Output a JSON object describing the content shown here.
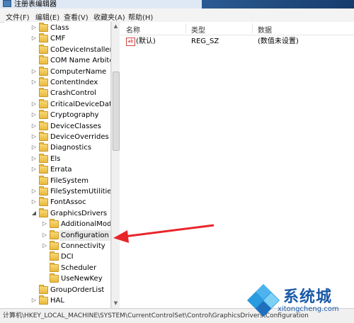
{
  "window": {
    "title": "注册表编辑器"
  },
  "menu": [
    "文件(F)",
    "编辑(E)",
    "查看(V)",
    "收藏夹(A)",
    "帮助(H)"
  ],
  "tree": [
    {
      "label": "Class",
      "indent": 0,
      "expander": "right"
    },
    {
      "label": "CMF",
      "indent": 0,
      "expander": "right"
    },
    {
      "label": "CoDeviceInstallers",
      "indent": 0,
      "expander": "none"
    },
    {
      "label": "COM Name Arbiter",
      "indent": 0,
      "expander": "none"
    },
    {
      "label": "ComputerName",
      "indent": 0,
      "expander": "right"
    },
    {
      "label": "ContentIndex",
      "indent": 0,
      "expander": "right"
    },
    {
      "label": "CrashControl",
      "indent": 0,
      "expander": "none"
    },
    {
      "label": "CriticalDeviceDatab",
      "indent": 0,
      "expander": "right"
    },
    {
      "label": "Cryptography",
      "indent": 0,
      "expander": "right"
    },
    {
      "label": "DeviceClasses",
      "indent": 0,
      "expander": "right"
    },
    {
      "label": "DeviceOverrides",
      "indent": 0,
      "expander": "right"
    },
    {
      "label": "Diagnostics",
      "indent": 0,
      "expander": "right"
    },
    {
      "label": "Els",
      "indent": 0,
      "expander": "right"
    },
    {
      "label": "Errata",
      "indent": 0,
      "expander": "right"
    },
    {
      "label": "FileSystem",
      "indent": 0,
      "expander": "none"
    },
    {
      "label": "FileSystemUtilities",
      "indent": 0,
      "expander": "right"
    },
    {
      "label": "FontAssoc",
      "indent": 0,
      "expander": "right"
    },
    {
      "label": "GraphicsDrivers",
      "indent": 0,
      "expander": "down"
    },
    {
      "label": "AdditionalMode",
      "indent": 1,
      "expander": "right"
    },
    {
      "label": "Configuration",
      "indent": 1,
      "expander": "right",
      "selected": true
    },
    {
      "label": "Connectivity",
      "indent": 1,
      "expander": "right"
    },
    {
      "label": "DCI",
      "indent": 1,
      "expander": "none"
    },
    {
      "label": "Scheduler",
      "indent": 1,
      "expander": "none"
    },
    {
      "label": "UseNewKey",
      "indent": 1,
      "expander": "none"
    },
    {
      "label": "GroupOrderList",
      "indent": 0,
      "expander": "none"
    },
    {
      "label": "HAL",
      "indent": 0,
      "expander": "right"
    }
  ],
  "list": {
    "columns": [
      "名称",
      "类型",
      "数据"
    ],
    "rows": [
      {
        "icon": "ab",
        "name": "(默认)",
        "type": "REG_SZ",
        "data": "(数值未设置)"
      }
    ]
  },
  "status": {
    "path": "计算机\\HKEY_LOCAL_MACHINE\\SYSTEM\\CurrentControlSet\\Control\\GraphicsDrivers\\Configuration"
  },
  "watermark": {
    "brand": "系统城",
    "url": "xitongcheng.com"
  },
  "colors": {
    "arrow": "#e8262a",
    "brand": "#1a5aa8"
  }
}
